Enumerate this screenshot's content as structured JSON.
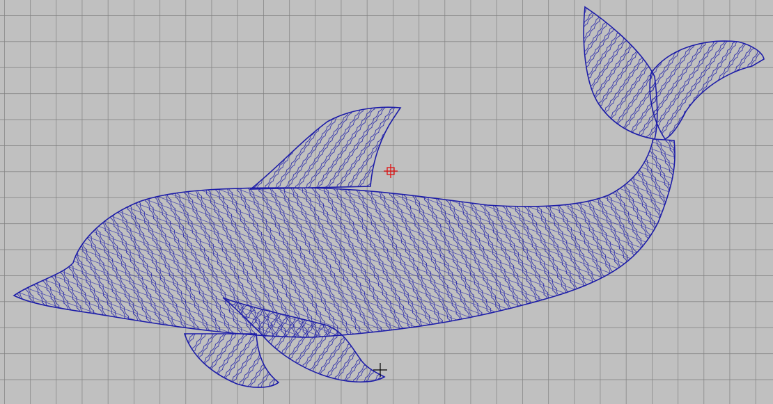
{
  "canvas": {
    "design_name": "dolphin",
    "colors": {
      "background": "#c0c0c0",
      "grid": "#808080",
      "stitch": "#1c1ca8",
      "origin_marker": "#e01010"
    }
  }
}
